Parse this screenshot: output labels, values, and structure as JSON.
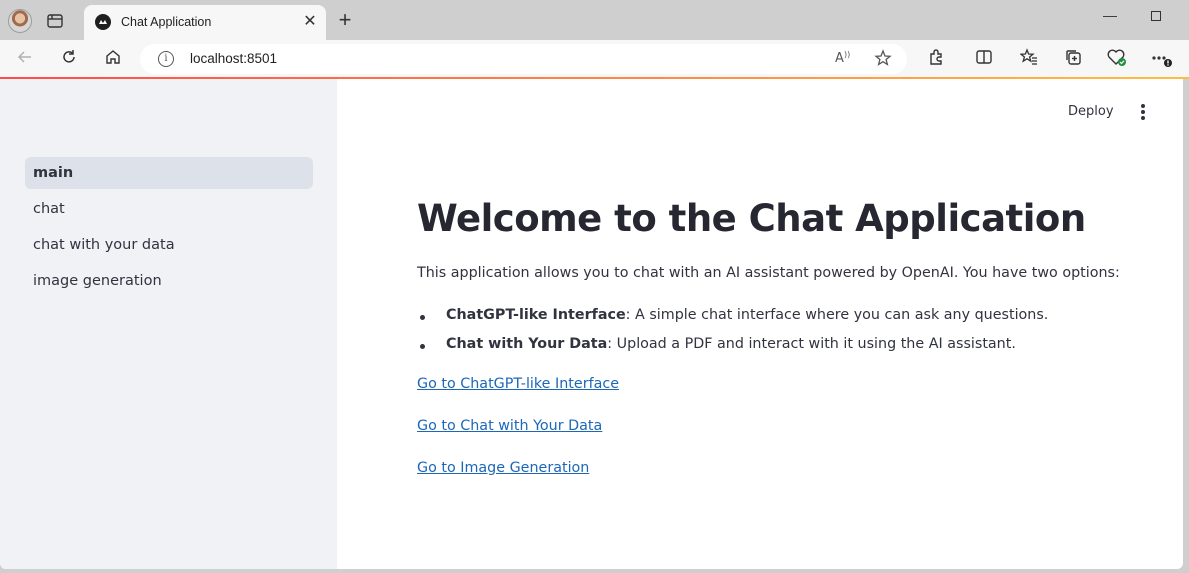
{
  "browser": {
    "tab_title": "Chat Application",
    "tab_close": "✕",
    "new_tab": "+",
    "address": "localhost:8501",
    "window_min": "—"
  },
  "sidebar": {
    "items": [
      {
        "label": "main",
        "active": true
      },
      {
        "label": "chat",
        "active": false
      },
      {
        "label": "chat with your data",
        "active": false
      },
      {
        "label": "image generation",
        "active": false
      }
    ]
  },
  "header": {
    "deploy_label": "Deploy"
  },
  "main": {
    "title": "Welcome to the Chat Application",
    "intro": "This application allows you to chat with an AI assistant powered by OpenAI. You have two options:",
    "bullets": [
      {
        "bold": "ChatGPT-like Interface",
        "text": ": A simple chat interface where you can ask any questions."
      },
      {
        "bold": "Chat with Your Data",
        "text": ": Upload a PDF and interact with it using the AI assistant."
      }
    ],
    "links": [
      "Go to ChatGPT-like Interface",
      "Go to Chat with Your Data",
      "Go to Image Generation"
    ]
  },
  "colors": {
    "sidebar_bg": "#f0f2f6",
    "link": "#1c67b8",
    "text": "#31333f",
    "accent_gradient_start": "#ff4b4b",
    "accent_gradient_end": "#ffbd45"
  }
}
